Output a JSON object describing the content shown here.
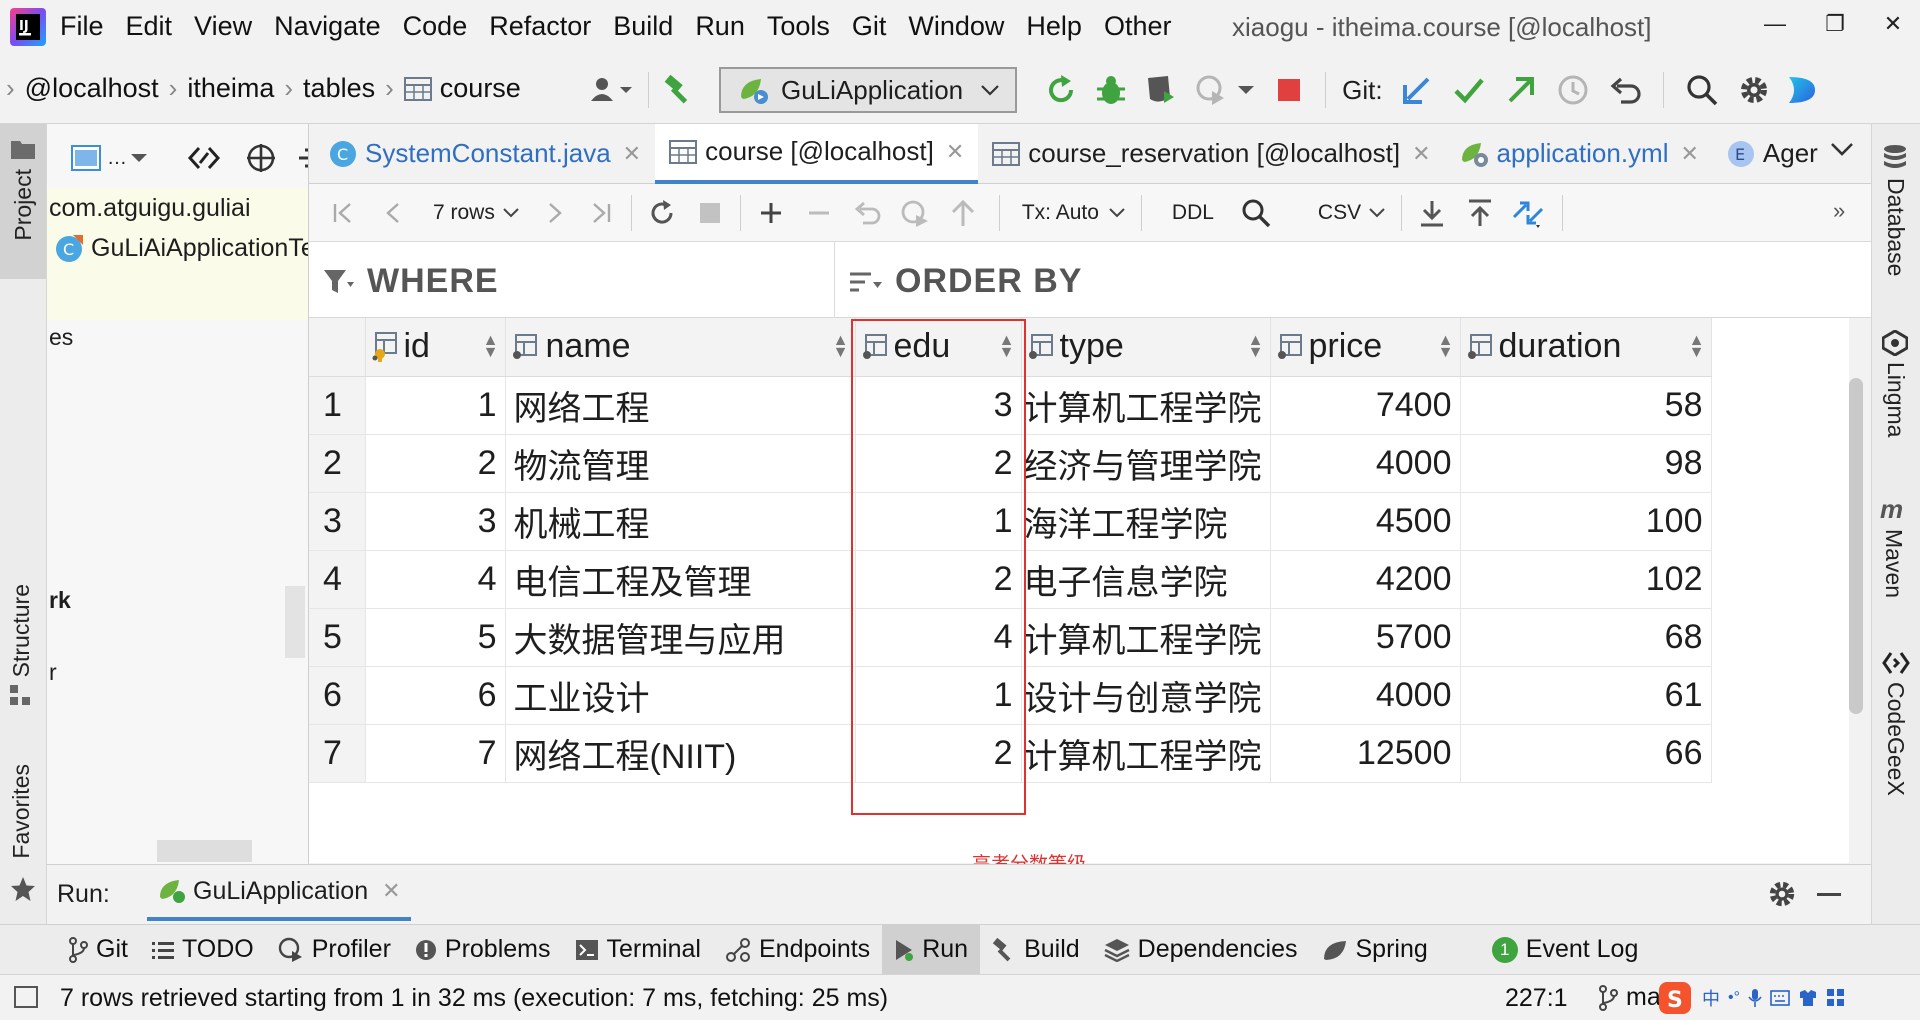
{
  "app": {
    "window_title": "xiaogu - itheima.course [@localhost]"
  },
  "menu": [
    "File",
    "Edit",
    "View",
    "Navigate",
    "Code",
    "Refactor",
    "Build",
    "Run",
    "Tools",
    "Git",
    "Window",
    "Help",
    "Other"
  ],
  "breadcrumb": [
    "@localhost",
    "itheima",
    "tables",
    "course"
  ],
  "toolbar": {
    "run_config": "GuLiApplication",
    "git_label": "Git:"
  },
  "left_strip": {
    "project": "Project",
    "structure": "Structure",
    "favorites": "Favorites"
  },
  "project_pane": {
    "package": "com.atguigu.guliai",
    "class_item": "GuLiAiApplicationTe",
    "partial_1": "es",
    "partial_2": "rk",
    "partial_3": "r"
  },
  "right_strip": [
    "Database",
    "Lingma",
    "Maven",
    "CodeGeeX"
  ],
  "tabs": [
    {
      "label": "SystemConstant.java",
      "active": false
    },
    {
      "label": "course [@localhost]",
      "active": true
    },
    {
      "label": "course_reservation [@localhost]",
      "active": false
    },
    {
      "label": "application.yml",
      "active": false
    },
    {
      "label": "Ager",
      "active": false
    }
  ],
  "grid_toolbar": {
    "rows": "7 rows",
    "tx": "Tx: Auto",
    "ddl": "DDL",
    "export": "CSV"
  },
  "filter": {
    "where": "WHERE",
    "order_by": "ORDER BY"
  },
  "table": {
    "columns": [
      "id",
      "name",
      "edu",
      "type",
      "price",
      "duration"
    ],
    "rows": [
      {
        "n": "1",
        "id": "1",
        "name": "网络工程",
        "edu": "3",
        "type": "计算机工程学院",
        "price": "7400",
        "duration": "58"
      },
      {
        "n": "2",
        "id": "2",
        "name": "物流管理",
        "edu": "2",
        "type": "经济与管理学院",
        "price": "4000",
        "duration": "98"
      },
      {
        "n": "3",
        "id": "3",
        "name": "机械工程",
        "edu": "1",
        "type": "海洋工程学院",
        "price": "4500",
        "duration": "100"
      },
      {
        "n": "4",
        "id": "4",
        "name": "电信工程及管理",
        "edu": "2",
        "type": "电子信息学院",
        "price": "4200",
        "duration": "102"
      },
      {
        "n": "5",
        "id": "5",
        "name": "大数据管理与应用",
        "edu": "4",
        "type": "计算机工程学院",
        "price": "5700",
        "duration": "68"
      },
      {
        "n": "6",
        "id": "6",
        "name": "工业设计",
        "edu": "1",
        "type": "设计与创意学院",
        "price": "4000",
        "duration": "61"
      },
      {
        "n": "7",
        "id": "7",
        "name": "网络工程(NIIT)",
        "edu": "2",
        "type": "计算机工程学院",
        "price": "12500",
        "duration": "66"
      }
    ]
  },
  "annotation": "高考分数等级",
  "run_bar": {
    "label": "Run:",
    "tab": "GuLiApplication"
  },
  "bottom_tools": [
    {
      "label": "Git",
      "icon": "git-branch-icon"
    },
    {
      "label": "TODO",
      "icon": "list-icon"
    },
    {
      "label": "Profiler",
      "icon": "profiler-icon"
    },
    {
      "label": "Problems",
      "icon": "warning-icon"
    },
    {
      "label": "Terminal",
      "icon": "terminal-icon"
    },
    {
      "label": "Endpoints",
      "icon": "endpoints-icon"
    },
    {
      "label": "Run",
      "icon": "play-icon",
      "active": true
    },
    {
      "label": "Build",
      "icon": "hammer-icon"
    },
    {
      "label": "Dependencies",
      "icon": "layers-icon"
    },
    {
      "label": "Spring",
      "icon": "leaf-icon"
    },
    {
      "label": "Event Log",
      "icon": "event-log-icon",
      "badge": "1"
    }
  ],
  "status": {
    "message": "7 rows retrieved starting from 1 in 32 ms (execution: 7 ms, fetching: 25 ms)",
    "position": "227:1",
    "branch": "ma"
  },
  "colors": {
    "accent": "#4083c9",
    "highlight": "#e0312f",
    "run_green": "#3fa33f",
    "stop_red": "#e04040"
  }
}
